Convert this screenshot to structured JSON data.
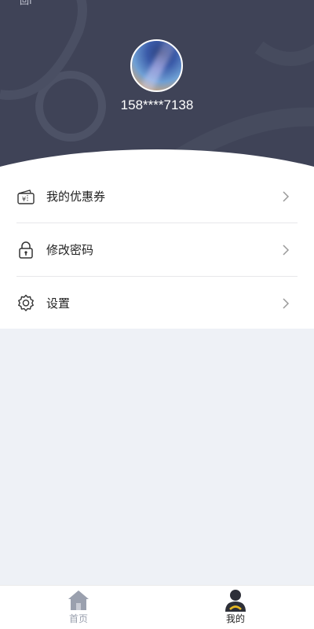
{
  "profile": {
    "phone": "158****7138",
    "status_text": "回f"
  },
  "menu": {
    "items": [
      {
        "label": "我的优惠券",
        "icon": "coupon-icon"
      },
      {
        "label": "修改密码",
        "icon": "lock-icon"
      },
      {
        "label": "设置",
        "icon": "gear-icon"
      }
    ]
  },
  "tabbar": {
    "tabs": [
      {
        "label": "首页",
        "icon": "home-icon",
        "active": false
      },
      {
        "label": "我的",
        "icon": "user-icon",
        "active": true
      }
    ]
  },
  "colors": {
    "header_bg": "#3f4357",
    "page_bg": "#eef1f6",
    "active_tab": "#222222",
    "inactive_tab": "#9aa0ae"
  }
}
